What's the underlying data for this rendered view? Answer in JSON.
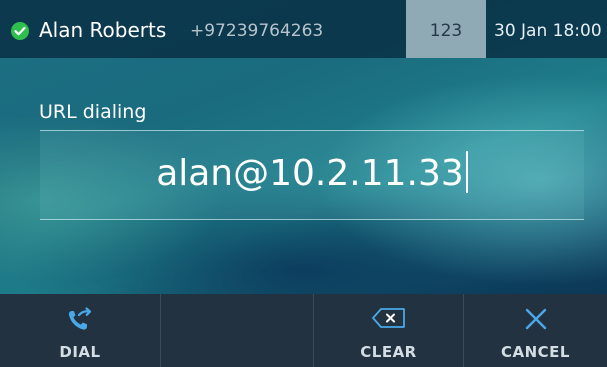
{
  "status_bar": {
    "caller_name": "Alan Roberts",
    "caller_number": "+97239764263",
    "line_key_label": "123",
    "date_time": "30 Jan 18:00"
  },
  "dialing": {
    "label": "URL dialing",
    "value": "alan@10.2.11.33"
  },
  "softkeys": [
    {
      "label": "DIAL",
      "icon": "phone-transfer-icon"
    },
    {
      "label": "",
      "icon": ""
    },
    {
      "label": "CLEAR",
      "icon": "backspace-icon"
    },
    {
      "label": "CANCEL",
      "icon": "close-icon"
    }
  ],
  "colors": {
    "registered_status": "#2fbf4f",
    "accent_blue": "#4aa8e8",
    "softkey_bar": "#223241",
    "line_key": "#8fa9b5"
  }
}
